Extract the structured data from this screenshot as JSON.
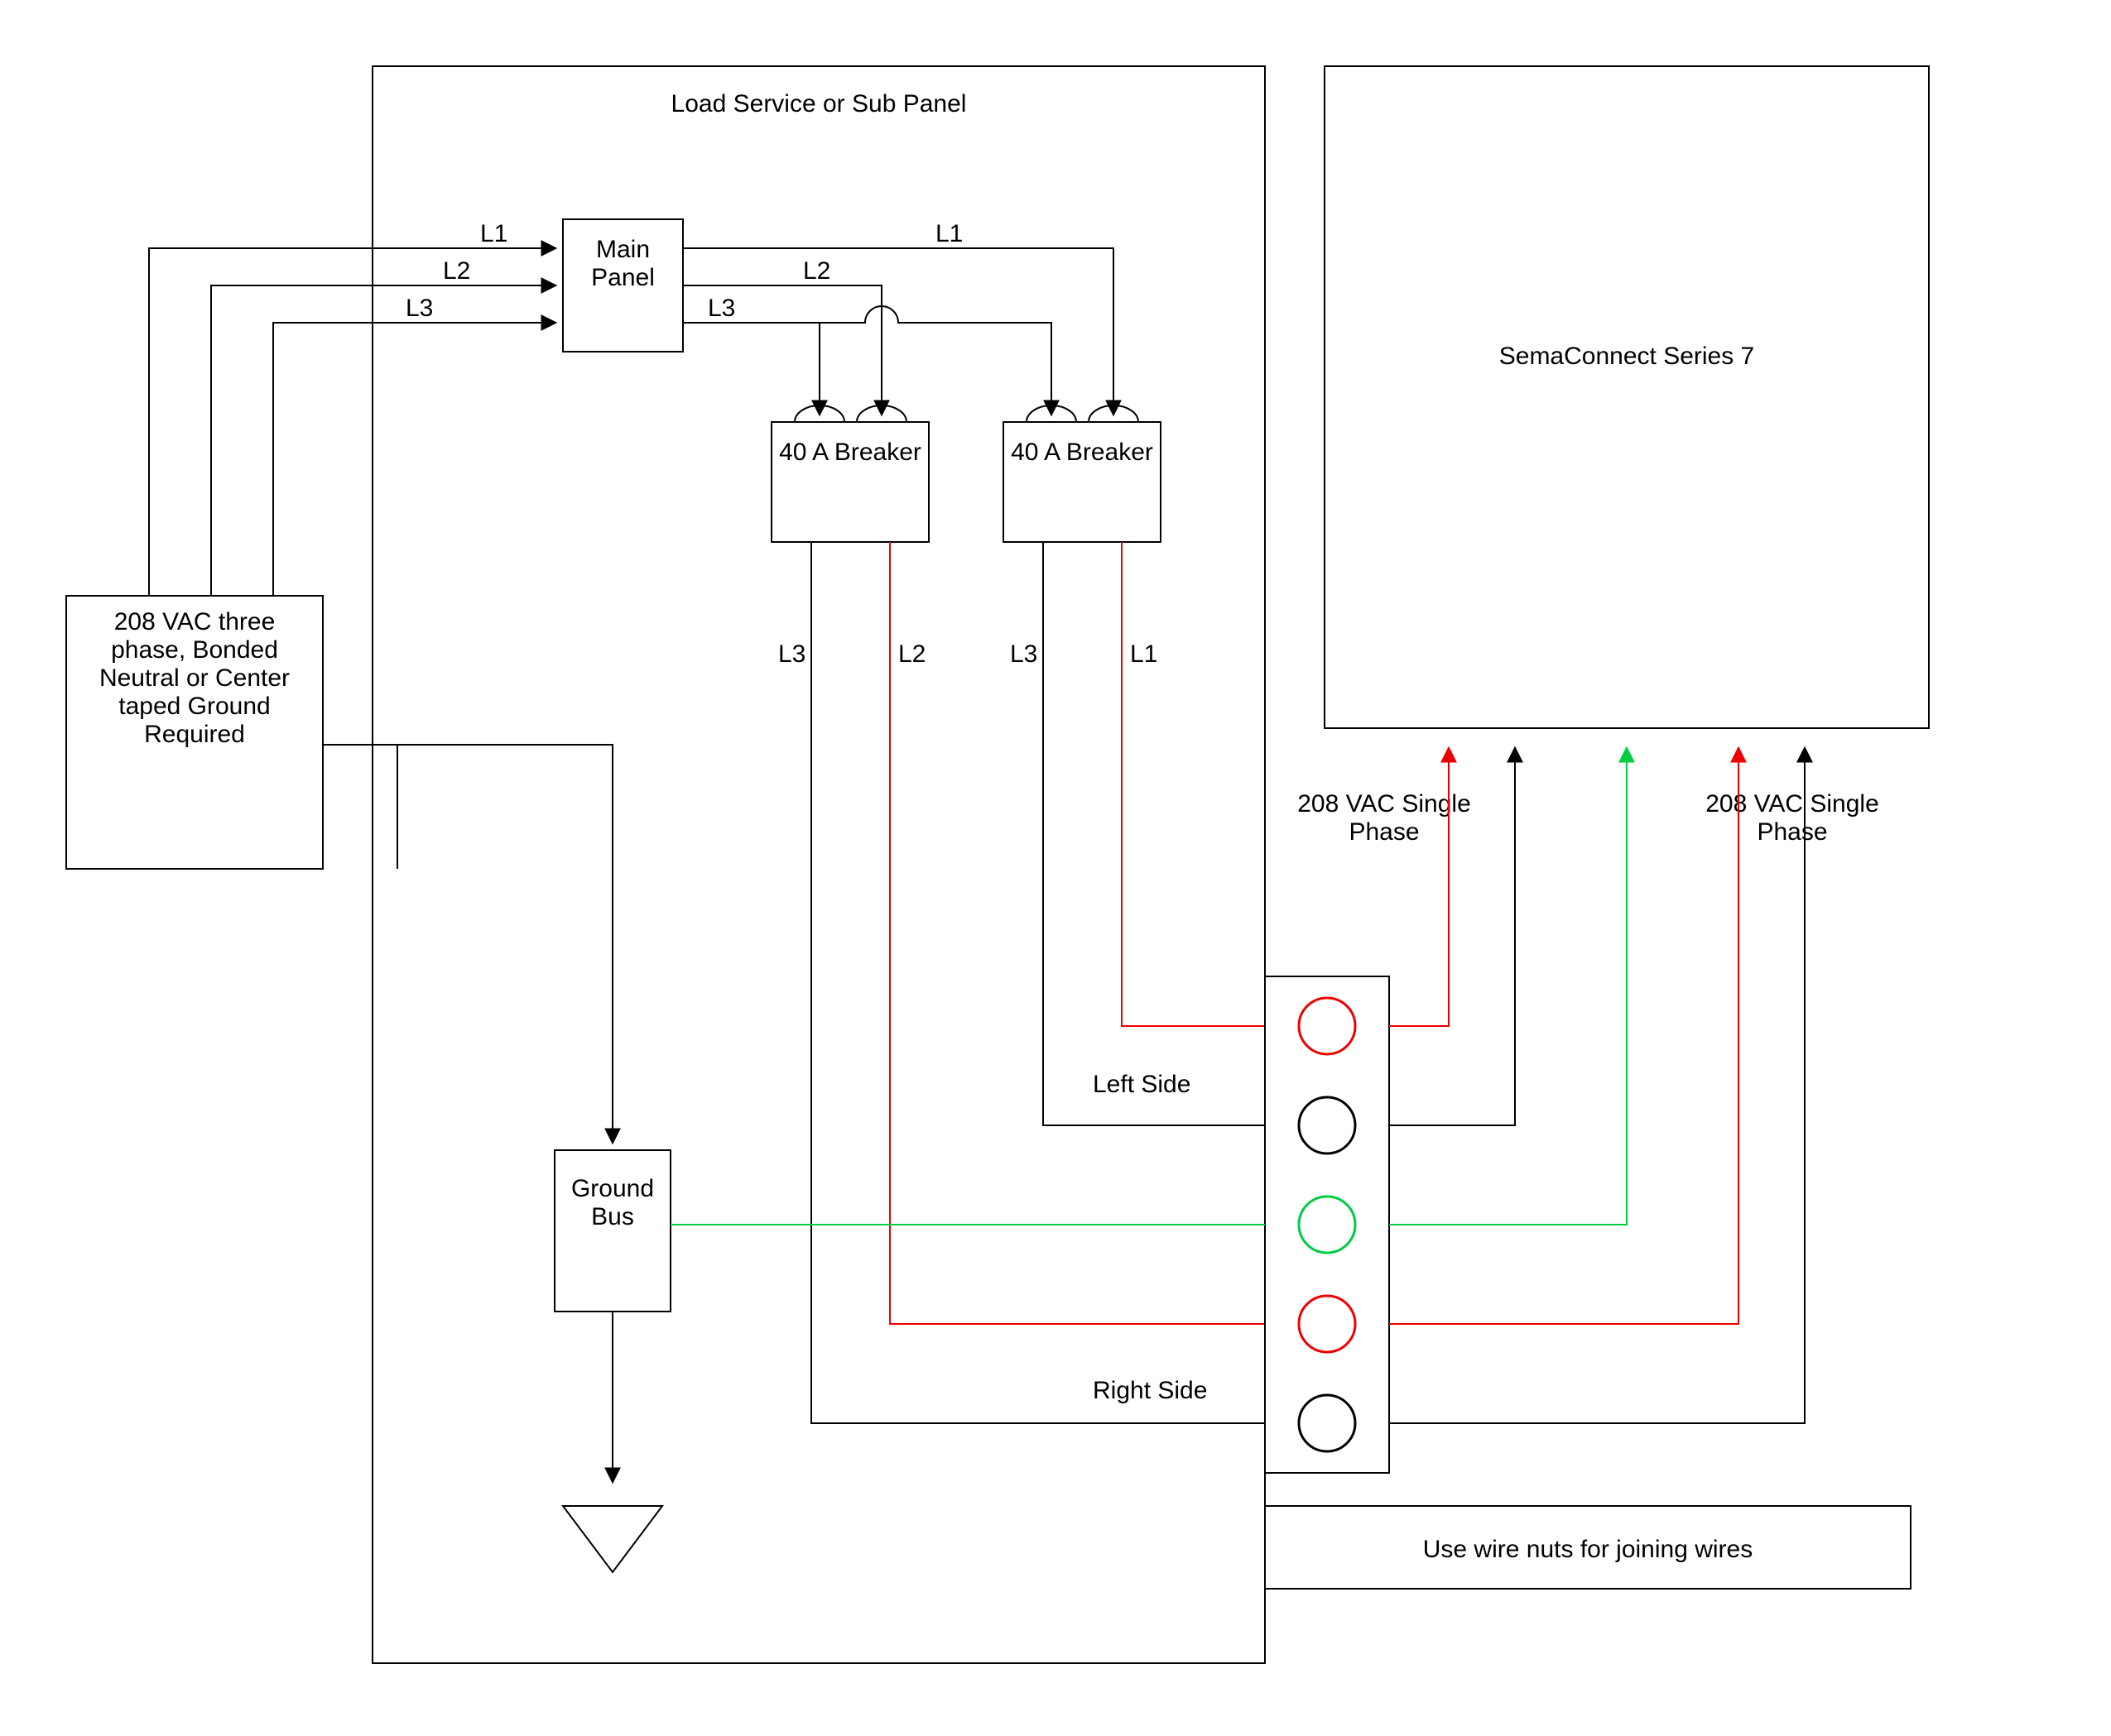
{
  "panel_title": "Load Service or Sub Panel",
  "power_source": "208 VAC three phase, Bonded Neutral or Center taped Ground Required",
  "main_panel": "Main Panel",
  "breaker_label": "40 A Breaker",
  "ground_bus": "Ground Bus",
  "device": "SemaConnect Series 7",
  "phase_note": "208 VAC Single Phase",
  "left_side": "Left Side",
  "right_side": "Right Side",
  "wire_note": "Use wire nuts for joining wires",
  "lines": {
    "L1": "L1",
    "L2": "L2",
    "L3": "L3"
  }
}
